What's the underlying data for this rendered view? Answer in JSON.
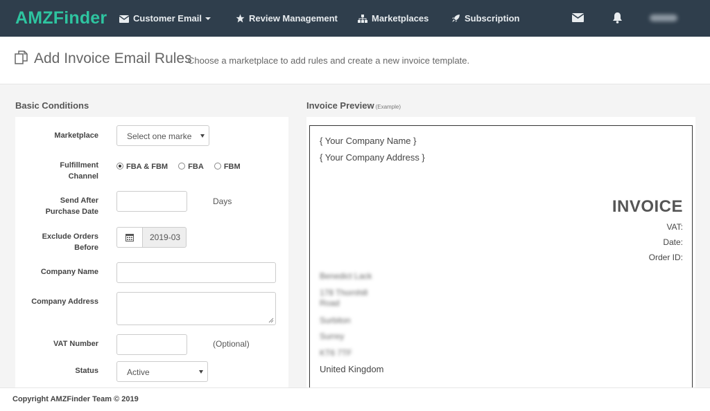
{
  "nav": {
    "brand": "AMZFinder",
    "items": [
      {
        "label": "Customer Email",
        "icon": "envelope-icon",
        "has_caret": true
      },
      {
        "label": "Review Management",
        "icon": "star-icon"
      },
      {
        "label": "Marketplaces",
        "icon": "sitemap-icon"
      },
      {
        "label": "Subscription",
        "icon": "rocket-icon"
      }
    ],
    "right_icons": [
      "mail-icon",
      "bell-icon"
    ],
    "user_name": "(blurred)"
  },
  "header": {
    "title": "Add Invoice Email Rules",
    "subtitle": "Choose a marketplace to add rules and create a new invoice template."
  },
  "basic": {
    "heading": "Basic Conditions",
    "marketplace_label": "Marketplace",
    "marketplace_value": "Select one marke",
    "fulfillment_label_1": "Fulfillment",
    "fulfillment_label_2": "Channel",
    "radio_options": [
      {
        "label": "FBA & FBM",
        "selected": true
      },
      {
        "label": "FBA",
        "selected": false
      },
      {
        "label": "FBM",
        "selected": false
      }
    ],
    "send_after_label_1": "Send After",
    "send_after_label_2": "Purchase Date",
    "send_after_value": "",
    "days_text": "Days",
    "exclude_label_1": "Exclude Orders",
    "exclude_label_2": "Before",
    "exclude_date": "2019-03",
    "company_name_label": "Company Name",
    "company_name_value": "",
    "company_address_label": "Company Address",
    "company_address_value": "",
    "vat_label": "VAT Number",
    "vat_value": "",
    "optional_text": "(Optional)",
    "status_label": "Status",
    "status_value": "Active"
  },
  "preview": {
    "heading": "Invoice Preview",
    "heading_note": "(Example)",
    "company_name": "{ Your Company Name }",
    "company_address": "{ Your Company Address }",
    "title": "INVOICE",
    "vat": "VAT:",
    "date": "Date:",
    "order_id": "Order ID:",
    "blurred_lines": [
      "Benedict Lack",
      "178 Thornhill",
      "Road",
      "Surbiton",
      "Surrey",
      "KT6 7TF"
    ],
    "country": "United Kingdom"
  },
  "footer": {
    "text": "Copyright AMZFinder Team © 2019"
  },
  "colors": {
    "navbar_bg": "#2f3e4c",
    "brand": "#2ec4a0",
    "content_bg": "#f4f4f4"
  }
}
